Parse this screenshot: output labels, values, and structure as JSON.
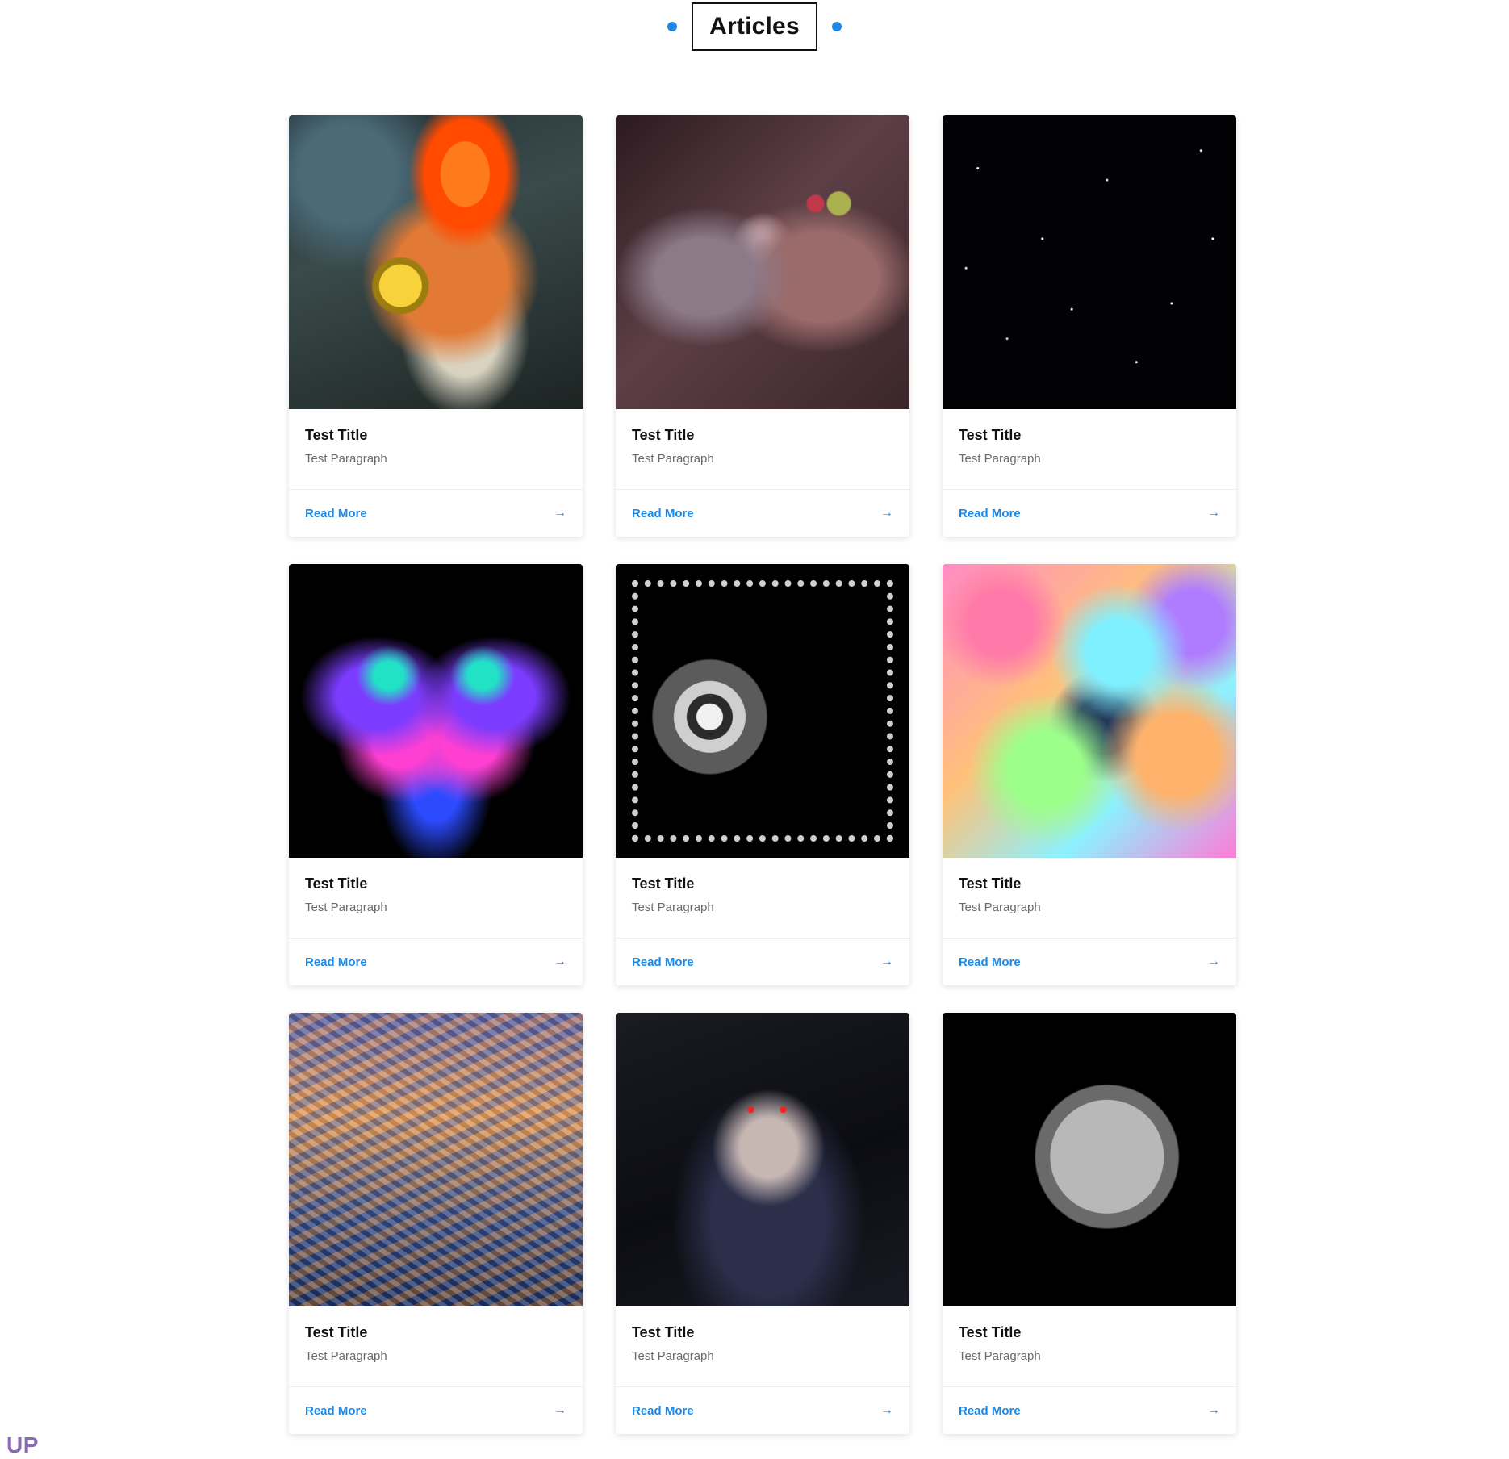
{
  "header": {
    "title": "Articles",
    "accent_color": "#1e88e5"
  },
  "cards": [
    {
      "title": "Test Title",
      "text": "Test Paragraph",
      "cta": "Read More",
      "arrow": "→",
      "image": "fire-sorcerer-art"
    },
    {
      "title": "Test Title",
      "text": "Test Paragraph",
      "cta": "Read More",
      "arrow": "→",
      "image": "armored-villain-art"
    },
    {
      "title": "Test Title",
      "text": "Test Paragraph",
      "cta": "Read More",
      "arrow": "→",
      "image": "starry-night-sky"
    },
    {
      "title": "Test Title",
      "text": "Test Paragraph",
      "cta": "Read More",
      "arrow": "→",
      "image": "neon-butterfly-art"
    },
    {
      "title": "Test Title",
      "text": "Test Paragraph",
      "cta": "Read More",
      "arrow": "→",
      "image": "mechanical-skull-illustration"
    },
    {
      "title": "Test Title",
      "text": "Test Paragraph",
      "cta": "Read More",
      "arrow": "→",
      "image": "colorful-clouds"
    },
    {
      "title": "Test Title",
      "text": "Test Paragraph",
      "cta": "Read More",
      "arrow": "→",
      "image": "low-poly-prism-landscape"
    },
    {
      "title": "Test Title",
      "text": "Test Paragraph",
      "cta": "Read More",
      "arrow": "→",
      "image": "anime-girl-dark"
    },
    {
      "title": "Test Title",
      "text": "Test Paragraph",
      "cta": "Read More",
      "arrow": "→",
      "image": "half-moon"
    }
  ],
  "floating": {
    "up_label": "UP"
  }
}
